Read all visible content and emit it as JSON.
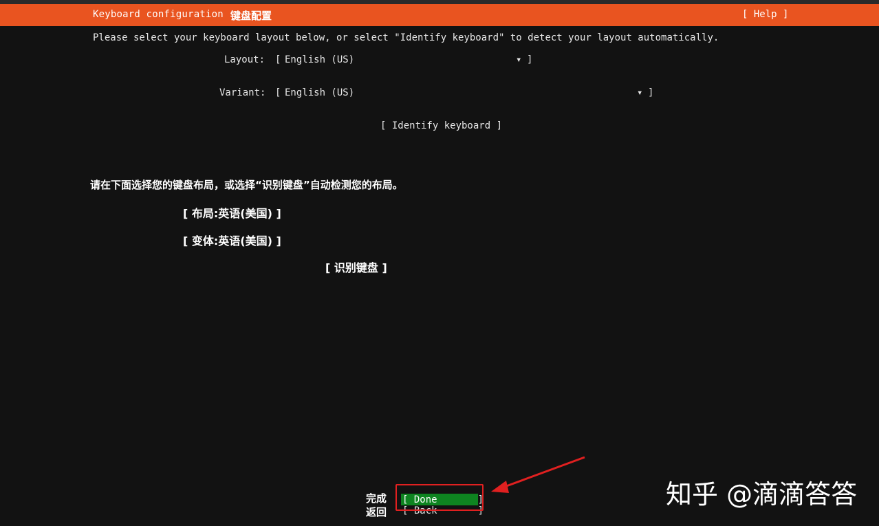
{
  "header": {
    "title": "Keyboard configuration",
    "title_cn": "键盘配置",
    "help_label": "[ Help ]",
    "accent_color": "#e95420"
  },
  "intro": "Please select your keyboard layout below, or select \"Identify keyboard\" to detect your layout automatically.",
  "layout": {
    "label": "Layout:",
    "open_bracket": "[",
    "value": "English (US)",
    "arrow": "▾",
    "close_bracket": "]"
  },
  "variant": {
    "label": "Variant:",
    "open_bracket": "[",
    "value": "English (US)",
    "arrow": "▾",
    "close_bracket": "]"
  },
  "identify_button": "[ Identify keyboard ]",
  "translation": {
    "intro": "请在下面选择您的键盘布局，或选择“识别键盘”自动检测您的布局。",
    "layout": "[ 布局:英语(美国) ]",
    "variant": "[ 变体:英语(美国) ]",
    "identify": "[ 识别键盘 ]",
    "done": "完成",
    "back": "返回"
  },
  "footer": {
    "done_label": "[ Done       ]",
    "back_label": "[ Back       ]",
    "done_color": "#0e8420"
  },
  "annotation": {
    "highlight_color": "#e02020"
  },
  "watermark": "知乎 @滴滴答答"
}
